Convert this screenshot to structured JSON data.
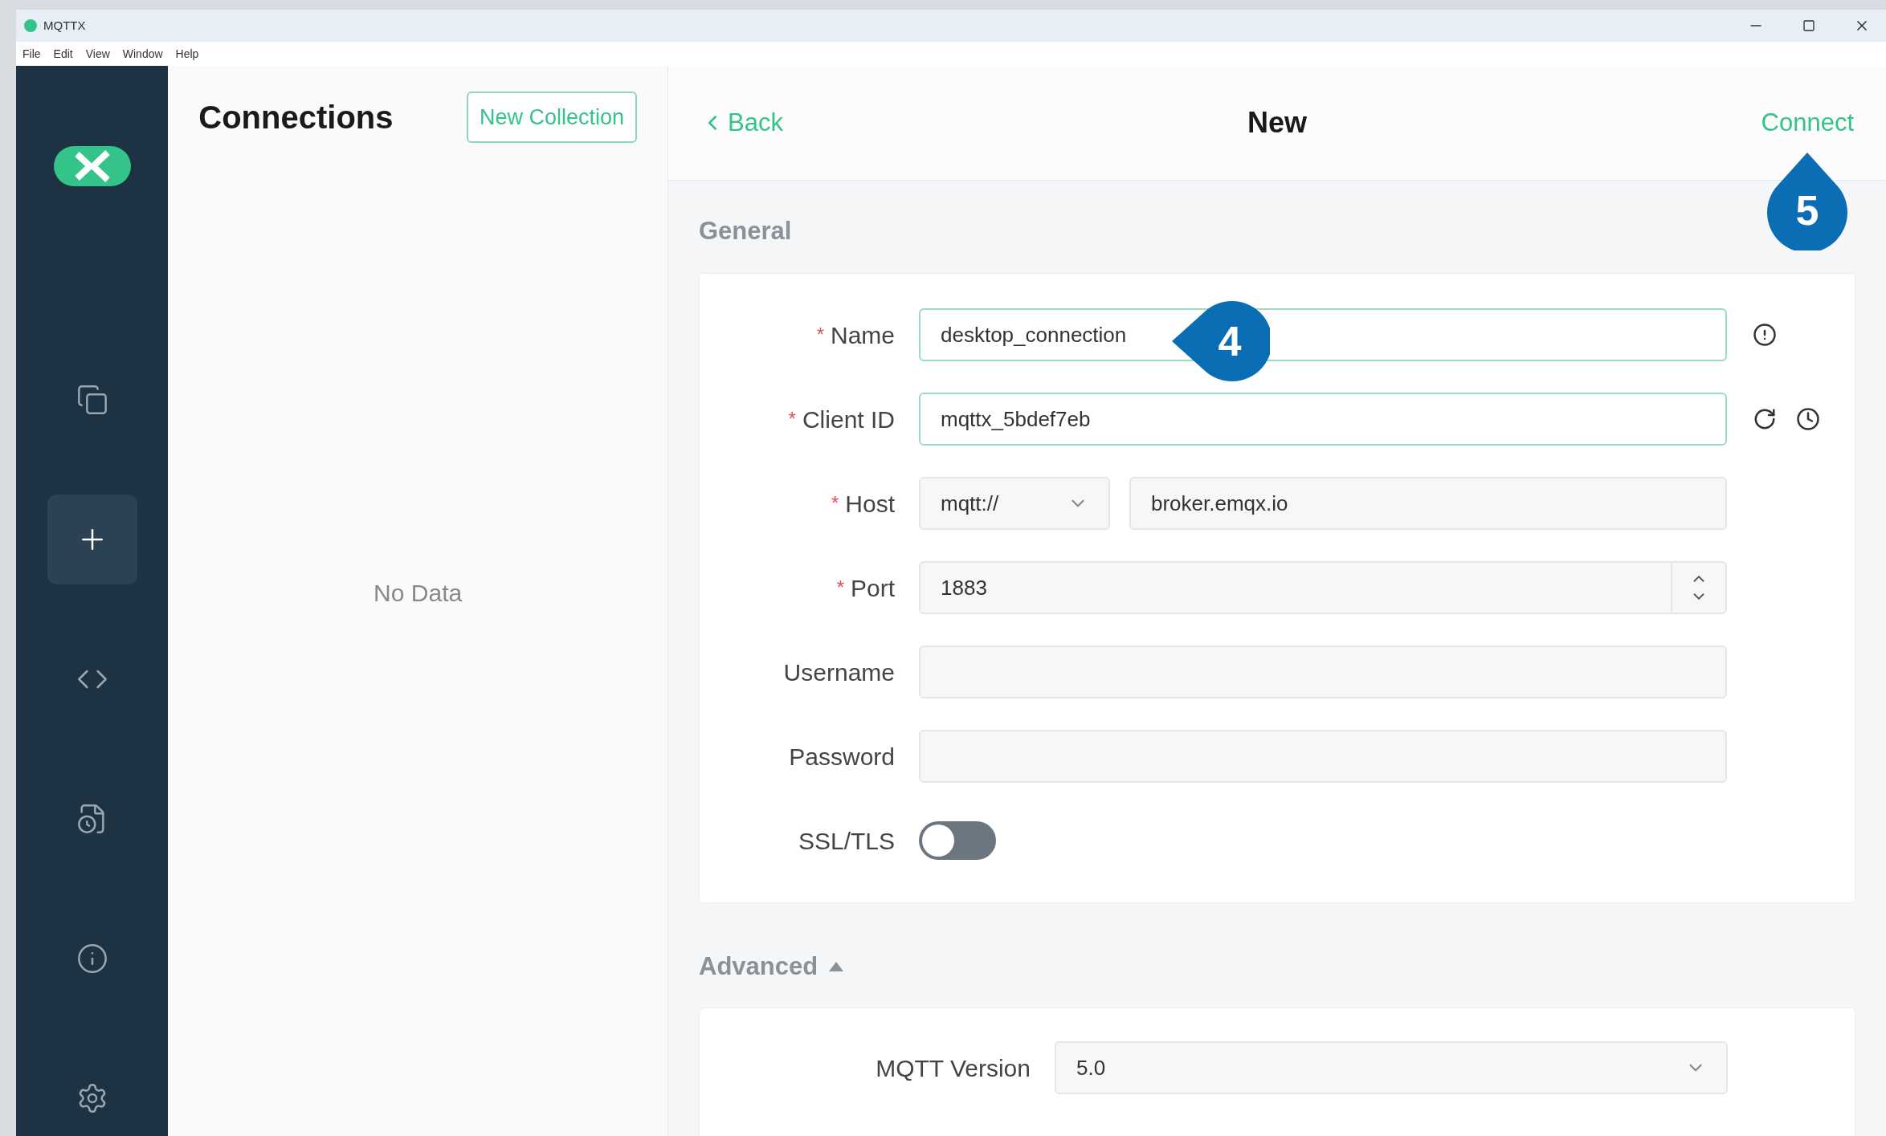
{
  "window": {
    "title": "MQTTX"
  },
  "menu": [
    "File",
    "Edit",
    "View",
    "Window",
    "Help"
  ],
  "sidebar": {
    "items": [
      {
        "selected": false
      },
      {
        "selected": true
      },
      {
        "selected": false
      },
      {
        "selected": false
      },
      {
        "selected": false
      },
      {
        "selected": false
      }
    ]
  },
  "connections": {
    "title": "Connections",
    "button": "New Collection",
    "empty": "No Data"
  },
  "header": {
    "back": "Back",
    "title": "New",
    "action": "Connect"
  },
  "callouts": [
    {
      "label": "5",
      "kind": "up"
    },
    {
      "label": "4",
      "kind": "left"
    }
  ],
  "general": {
    "title": "General",
    "fields": [
      {
        "kind": "name",
        "label": "Name",
        "marker": "*",
        "value": "desktop_connection"
      },
      {
        "kind": "client_id",
        "label": "Client ID",
        "marker": "*",
        "value": "mqttx_5bdef7eb"
      },
      {
        "kind": "host",
        "label": "Host",
        "marker": "*",
        "protocol": "mqtt://",
        "value": "broker.emqx.io"
      },
      {
        "kind": "port",
        "label": "Port",
        "marker": "*",
        "value": "1883"
      },
      {
        "kind": "text",
        "label": "Username"
      },
      {
        "kind": "text",
        "label": "Password"
      },
      {
        "kind": "switch",
        "label": "SSL/TLS",
        "on": false
      }
    ]
  },
  "advanced": {
    "title": "Advanced",
    "expanded": true,
    "fields": [
      {
        "kind": "select",
        "label": "MQTT Version",
        "value": "5.0"
      }
    ]
  }
}
